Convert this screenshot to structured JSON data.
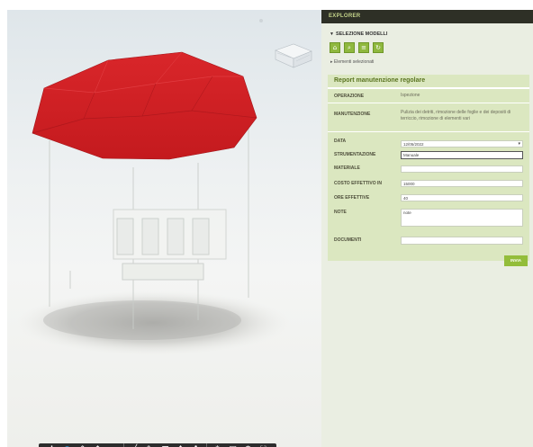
{
  "panel": {
    "header": "EXPLORER",
    "selection_title": "SELEZIONE MODELLI",
    "icons": [
      {
        "name": "home-icon",
        "glyph": "⌂"
      },
      {
        "name": "zoom-icon",
        "glyph": "⌕"
      },
      {
        "name": "list-icon",
        "glyph": "≡"
      },
      {
        "name": "refresh-icon",
        "glyph": "↻"
      }
    ],
    "selection_link": "Elementi selezionati",
    "send_label": "INVIA"
  },
  "report": {
    "title": "Report manutenzione regolare",
    "operazione": {
      "label": "OPERAZIONE",
      "value": "Ispezione"
    },
    "manutenzione": {
      "label": "MANUTENZIONE",
      "value": "Pulizia dei detriti, rimozione delle foglie e dei depositi di terriccio, rimozione di elementi vari"
    },
    "data": {
      "label": "DATA",
      "value": "12/05/2022"
    },
    "strumentazione": {
      "label": "STRUMENTAZIONE",
      "value": "Manuale"
    },
    "materiale": {
      "label": "MATERIALE",
      "value": ""
    },
    "costo": {
      "label": "COSTO EFFETTIVO IN",
      "value": "15000"
    },
    "ore": {
      "label": "ORE EFFETTIVE",
      "value": "40"
    },
    "note": {
      "label": "NOTE",
      "value": "note"
    },
    "documenti": {
      "label": "DOCUMENTI",
      "value": ""
    }
  },
  "toolbar": {
    "groups": [
      [
        {
          "name": "orbit-icon",
          "glyph": "✢",
          "active": false
        },
        {
          "name": "person-icon",
          "glyph": "●",
          "active": true
        },
        {
          "name": "walk-icon",
          "glyph": "⇕",
          "active": false
        },
        {
          "name": "pan-icon",
          "glyph": "↕",
          "active": false
        },
        {
          "name": "camera-icon",
          "glyph": "▬",
          "active": false
        }
      ],
      [
        {
          "name": "measure-icon",
          "glyph": "╱",
          "active": false
        },
        {
          "name": "markup-icon",
          "glyph": "✎",
          "active": false
        },
        {
          "name": "section-icon",
          "glyph": "■",
          "active": false
        },
        {
          "name": "explode-icon",
          "glyph": "✥",
          "active": false
        },
        {
          "name": "model-browser-icon",
          "glyph": "✤",
          "active": false
        }
      ],
      [
        {
          "name": "structure-icon",
          "glyph": "⁂",
          "active": false
        },
        {
          "name": "properties-icon",
          "glyph": "▤",
          "active": false
        },
        {
          "name": "settings-icon",
          "glyph": "⚙",
          "active": false
        },
        {
          "name": "fullscreen-icon",
          "glyph": "⛶",
          "active": false
        }
      ]
    ]
  },
  "colors": {
    "roof": "#d21e22",
    "accent_green": "#93bd3a",
    "header_bg": "#2e3026",
    "report_bg": "#dbe7c0"
  }
}
